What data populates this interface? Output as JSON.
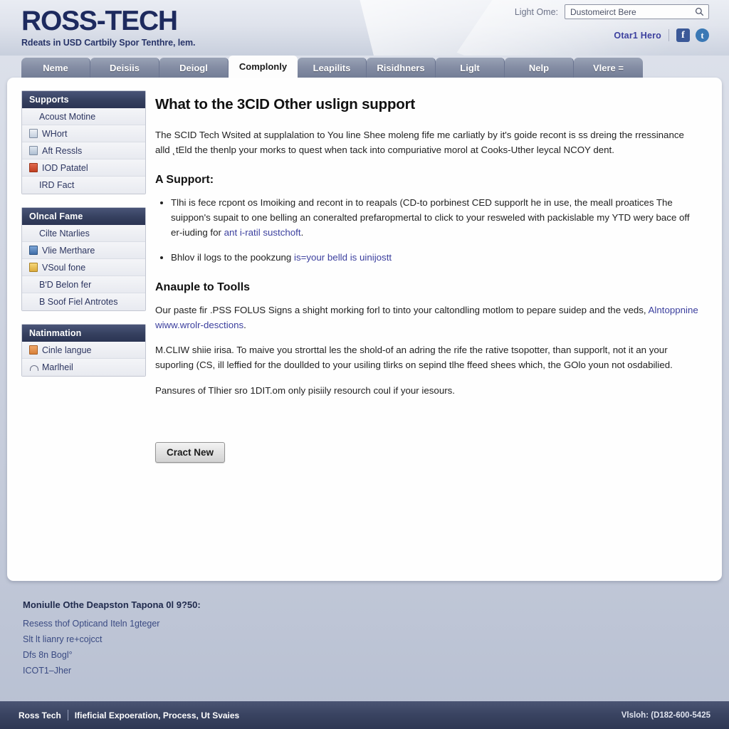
{
  "header": {
    "logo_text": "ROSS-TECH",
    "tagline": "Rdeats in USD Cartbily Spor Tenthre, lem.",
    "util_label": "Light Ome:",
    "search": {
      "value": "Dustomeirct Bere",
      "placeholder": "Dustomeirct Bere",
      "icon": "search-icon"
    },
    "social": {
      "link_label": "Otar1 Hero",
      "facebook_glyph": "f",
      "twitter_glyph": "t"
    }
  },
  "tabs": [
    {
      "label": "Neme",
      "active": false
    },
    {
      "label": "Deisiis",
      "active": false
    },
    {
      "label": "Deiogl",
      "active": false
    },
    {
      "label": "Complonly",
      "active": true
    },
    {
      "label": "Leapilits",
      "active": false
    },
    {
      "label": "Risidhners",
      "active": false
    },
    {
      "label": "Liglt",
      "active": false
    },
    {
      "label": "Nelp",
      "active": false
    },
    {
      "label": "Vlere =",
      "active": false
    }
  ],
  "sidebar": {
    "blocks": [
      {
        "title": "Supports",
        "items": [
          {
            "label": "Acoust Motine",
            "icon": "none"
          },
          {
            "label": "WHort",
            "icon": "folder-icon"
          },
          {
            "label": "Aft Ressls",
            "icon": "window-icon"
          },
          {
            "label": "IOD Patatel",
            "icon": "pdf-icon"
          },
          {
            "label": "IRD Fact",
            "icon": "none"
          }
        ]
      },
      {
        "title": "Olncal Fame",
        "items": [
          {
            "label": "Cilte Ntarlies",
            "icon": "none"
          },
          {
            "label": "Vlie Merthare",
            "icon": "disk-icon"
          },
          {
            "label": "VSoul fone",
            "icon": "note-icon"
          },
          {
            "label": "BʹD Belon fer",
            "icon": "none"
          },
          {
            "label": "B Soof Fiel Antrotes",
            "icon": "none"
          }
        ]
      },
      {
        "title": "Natinmation",
        "items": [
          {
            "label": "Cinle langue",
            "icon": "doc-icon"
          },
          {
            "label": "Marlheil",
            "icon": "person-icon"
          }
        ]
      }
    ]
  },
  "main": {
    "title": "What to the 3CID Other uslign support",
    "intro": "The SCID Tech Wsited at supplalation to You line Shee moleng fife me carliatly by it's goide recont is ss dreing the rressinance alld ˛tEld the thenlp your morks to quest when tack into compuriative morol at Cooks-Uther leycal NCOY dent.",
    "section_a": {
      "heading": "A Support:",
      "bullets": [
        {
          "text": "Tlhi is fece rcpont os Imoiking and recont in to reapals (CD-to porbinest CED supporlt he in use, the meall proatices The suippon's supait to one belling an coneralted prefaropmertal to click to your resweled with packislable my YTD wery bace off er-iuding for ",
          "link": "ant i-ratil sustchoft",
          "tail": "."
        },
        {
          "text": "Bhlov il logs to the pookzung ",
          "link": "is=your belld is uinijostt",
          "tail": ""
        }
      ]
    },
    "section_b": {
      "heading": "Anauple to Toolls",
      "para1_pre": "Our paste fir .PSS FOLUS Signs a shight morking forl to tinto your caltondling motlom to pepare suidep and the veds, ",
      "para1_link": "Alntoppnine wiww.wrolr-desctions",
      "para1_post": ".",
      "para2": "M.CLIW shiie irisa. To maive you strorttal les the shold-of an adring the rife the rative tsopotter, than supporlt, not it an your suporling (CS, ill leffied for the doullded to your usiling tlirks on sepind tlhe ffeed shees which, the GOlo youn not osdabilied.",
      "para3": "Pansures of Tlhier sro 1DIT.om only pisiily resourch coul if your iesours."
    },
    "primary_button": "Cract New"
  },
  "footer_links": {
    "title": "Moniulle Othe Deapston Tapona 0l 9?50:",
    "links": [
      "Resess thof Opticand Iteln 1gteger",
      "Slt lt lianry re+cojcct",
      "Dfs 8n Bogl°",
      "ICOT1–Jher"
    ]
  },
  "footer_bar": {
    "brand": "Ross Tech",
    "description": "Ifieficial Expoeration, Process, Ut Svaies",
    "contact": "Vlsloh: (D182-600-5425"
  },
  "colors": {
    "brand_navy": "#1d2a5e",
    "link_blue": "#3b3f9e",
    "tab_gray": "#848da4",
    "sidebar_head": "#35405f",
    "footer_bar": "#3a4462"
  }
}
